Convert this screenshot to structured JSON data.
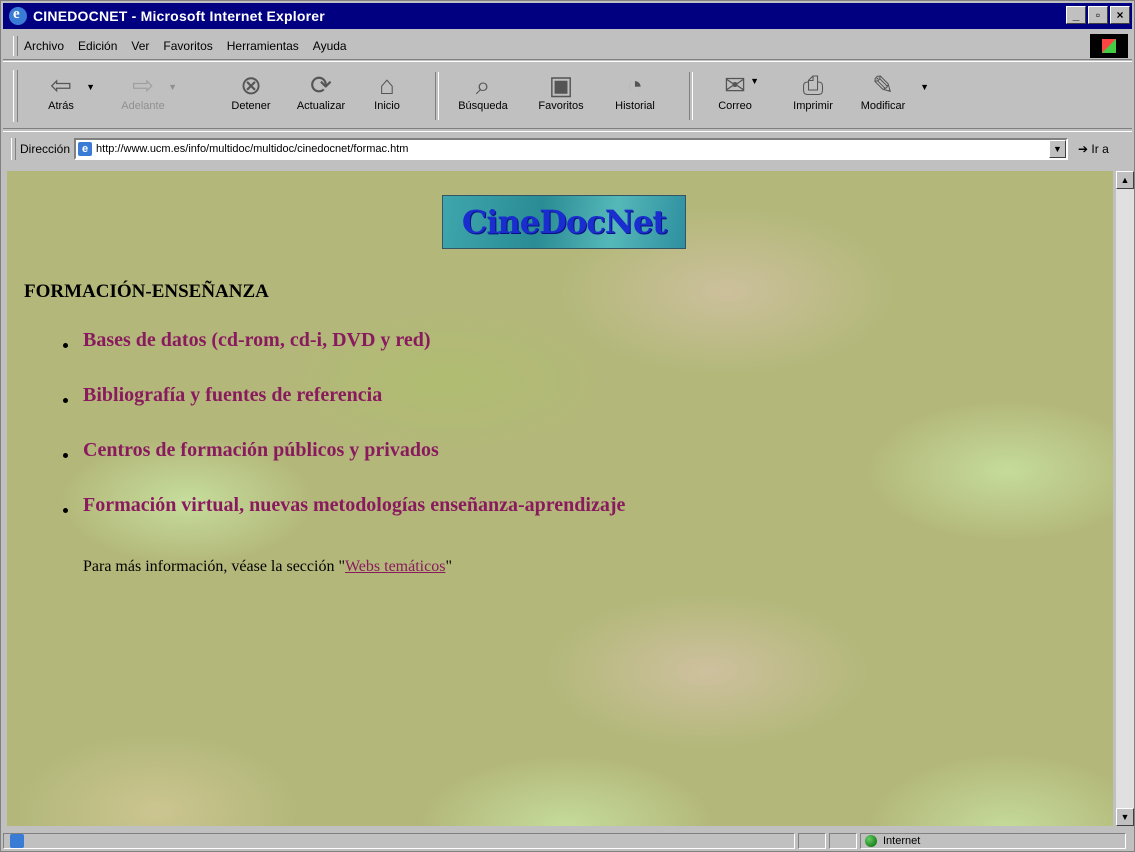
{
  "window": {
    "title": "CINEDOCNET - Microsoft Internet Explorer",
    "buttons": {
      "minimize": "_",
      "maximize": "▫",
      "close": "×"
    }
  },
  "menu": [
    "Archivo",
    "Edición",
    "Ver",
    "Favoritos",
    "Herramientas",
    "Ayuda"
  ],
  "toolbar": {
    "back": "Atrás",
    "forward": "Adelante",
    "stop": "Detener",
    "refresh": "Actualizar",
    "home": "Inicio",
    "search": "Búsqueda",
    "favorites": "Favoritos",
    "history": "Historial",
    "mail": "Correo",
    "print": "Imprimir",
    "edit": "Modificar"
  },
  "address": {
    "label": "Dirección",
    "url": "http://www.ucm.es/info/multidoc/multidoc/cinedocnet/formac.htm",
    "go": "Ir a"
  },
  "page": {
    "logo_text": "CineDocNet",
    "heading": "FORMACIÓN-ENSEÑANZA",
    "links": [
      "Bases de datos (cd-rom, cd-i, DVD y red)",
      "Bibliografía y fuentes de referencia",
      "Centros de formación públicos y privados",
      "Formación virtual, nuevas metodologías enseñanza-aprendizaje"
    ],
    "info_prefix": "Para más información, véase la sección \"",
    "info_link": "Webs temáticos",
    "info_suffix": "\""
  },
  "status": {
    "zone": "Internet"
  }
}
